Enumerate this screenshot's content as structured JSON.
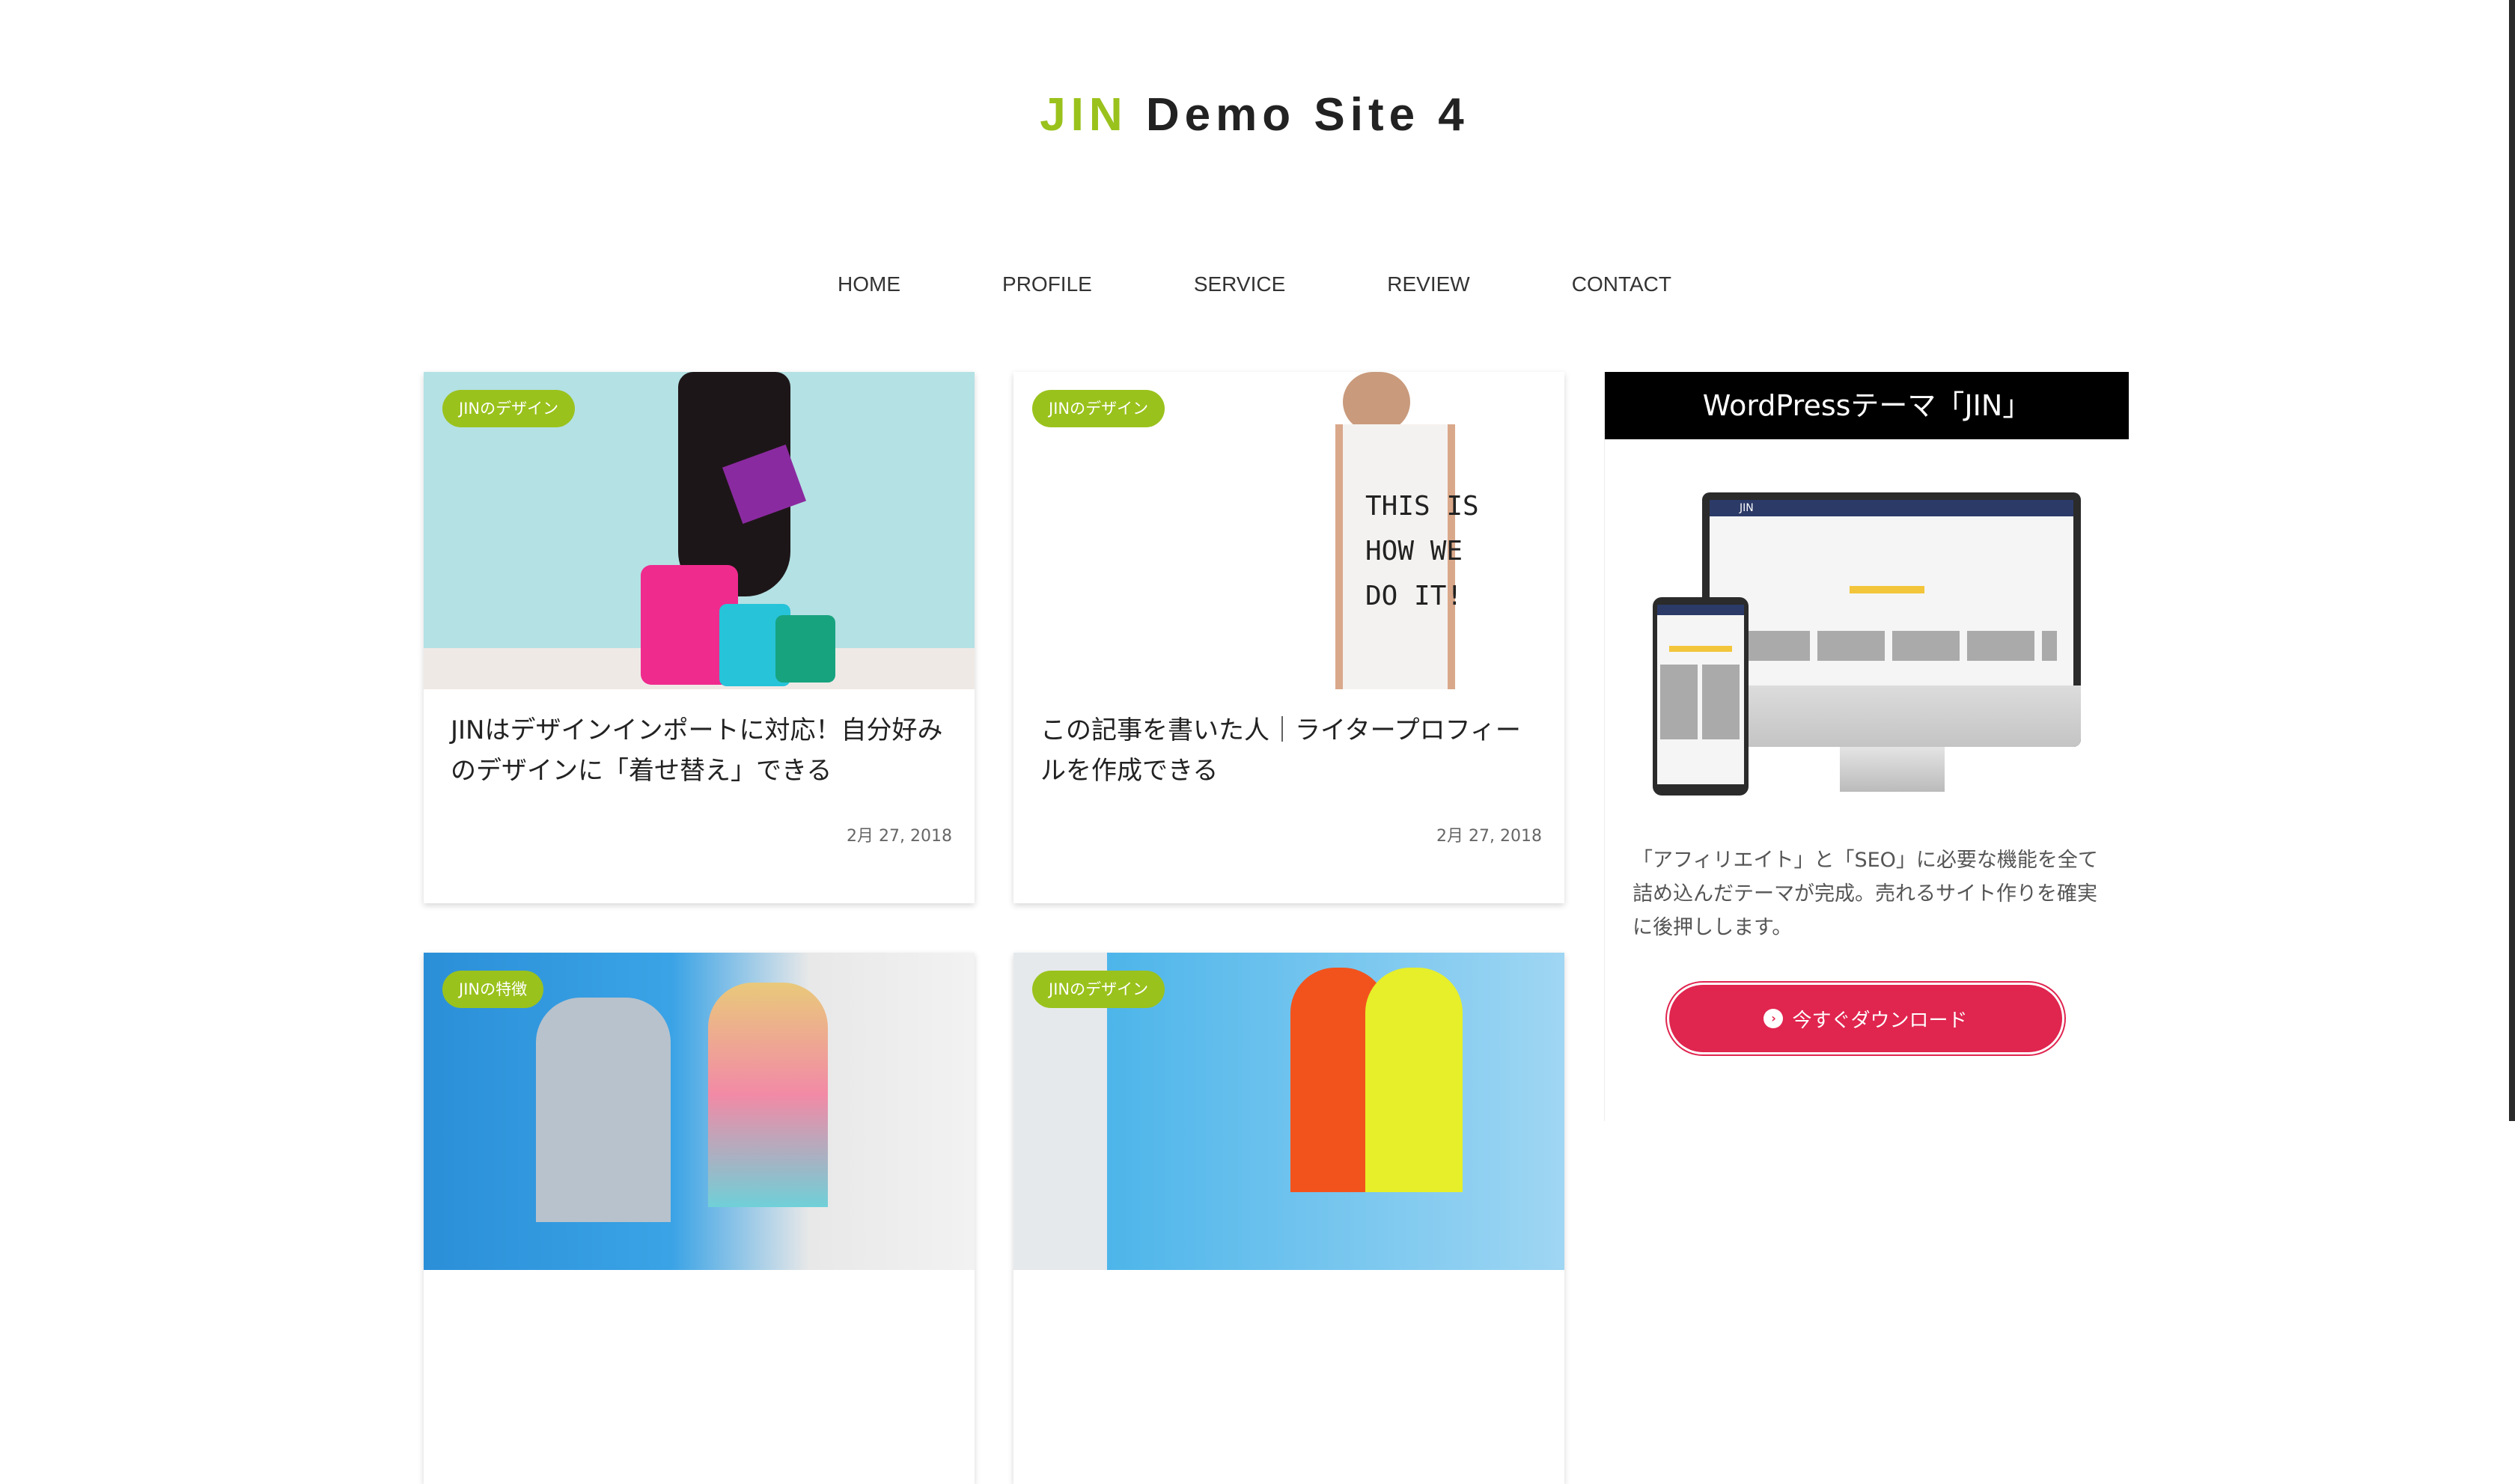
{
  "header": {
    "title_accent": "JIN",
    "title_rest": " Demo Site 4"
  },
  "nav": [
    "HOME",
    "PROFILE",
    "SERVICE",
    "REVIEW",
    "CONTACT"
  ],
  "posts": [
    {
      "tag": "JINのデザイン",
      "title": "JINはデザインインポートに対応！自分好みのデザインに「着せ替え」できる",
      "date": "2月 27, 2018"
    },
    {
      "tag": "JINのデザイン",
      "title": "この記事を書いた人｜ライタープロフィールを作成できる",
      "date": "2月 27, 2018"
    },
    {
      "tag": "JINの特徴"
    },
    {
      "tag": "JINのデザイン"
    }
  ],
  "sidebar": {
    "heading": "WordPressテーマ「JIN」",
    "mock_logo": "JIN",
    "text": "「アフィリエイト」と「SEO」に必要な機能を全て詰め込んだテーマが完成。売れるサイト作りを確実に後押しします。",
    "button": "今すぐダウンロード",
    "button_icon": "chevron-circle-right-icon"
  },
  "colors": {
    "accent": "#9ac21c",
    "button": "#e0254f"
  }
}
